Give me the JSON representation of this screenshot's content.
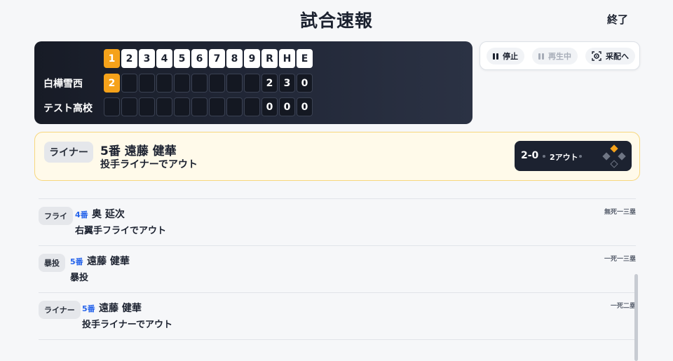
{
  "header": {
    "title": "試合速報",
    "end_label": "終了"
  },
  "scoreboard": {
    "headers": [
      "1",
      "2",
      "3",
      "4",
      "5",
      "6",
      "7",
      "8",
      "9",
      "R",
      "H",
      "E"
    ],
    "active_inning": 1,
    "teams": [
      {
        "name": "白樺雪西",
        "innings": [
          "2",
          "",
          "",
          "",
          "",
          "",
          "",
          "",
          ""
        ],
        "r": "2",
        "h": "3",
        "e": "0"
      },
      {
        "name": "テスト高校",
        "innings": [
          "",
          "",
          "",
          "",
          "",
          "",
          "",
          "",
          ""
        ],
        "r": "0",
        "h": "0",
        "e": "0"
      }
    ]
  },
  "controls": {
    "pause_label": "停止",
    "play_label": "再生中",
    "pitch_label": "采配へ"
  },
  "current_play": {
    "badge": "ライナー",
    "batter": "5番 遠藤 健華",
    "result": "投手ライナーでアウト",
    "score": "2-0",
    "outs": "2アウト",
    "bases": {
      "first": false,
      "second": true,
      "third": false
    }
  },
  "plays": [
    {
      "badge": "フライ",
      "number": "4番",
      "name": "奥 延次",
      "result": "右翼手フライでアウト",
      "runners": "無死一三塁"
    },
    {
      "badge": "暴投",
      "number": "5番",
      "name": "遠藤 健華",
      "result": "暴投",
      "runners": "一死一三塁"
    },
    {
      "badge": "ライナー",
      "number": "5番",
      "name": "遠藤 健華",
      "result": "投手ライナーでアウト",
      "runners": "一死二塁"
    }
  ],
  "colors": {
    "accent": "#f5a21a",
    "board_bg": "#1c2230",
    "number_blue": "#2563eb",
    "highlight_bg": "#fffaea"
  }
}
